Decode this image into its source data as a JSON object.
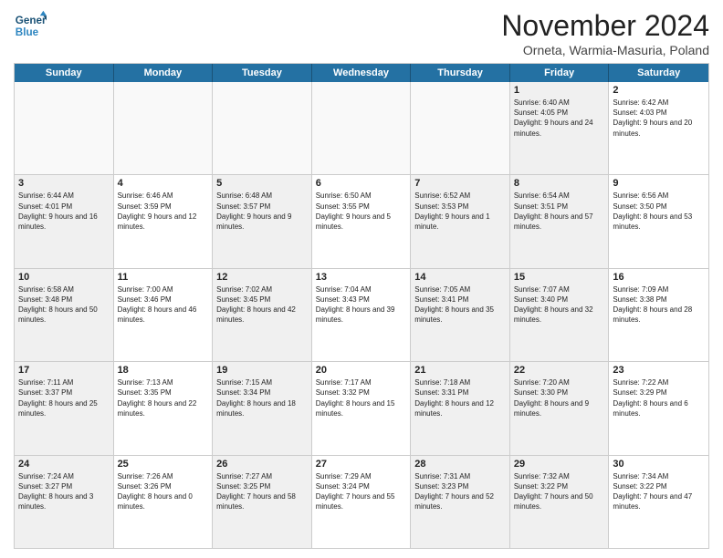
{
  "header": {
    "logo_line1": "General",
    "logo_line2": "Blue",
    "month_title": "November 2024",
    "subtitle": "Orneta, Warmia-Masuria, Poland"
  },
  "weekdays": [
    "Sunday",
    "Monday",
    "Tuesday",
    "Wednesday",
    "Thursday",
    "Friday",
    "Saturday"
  ],
  "rows": [
    [
      {
        "day": "",
        "info": "",
        "empty": true
      },
      {
        "day": "",
        "info": "",
        "empty": true
      },
      {
        "day": "",
        "info": "",
        "empty": true
      },
      {
        "day": "",
        "info": "",
        "empty": true
      },
      {
        "day": "",
        "info": "",
        "empty": true
      },
      {
        "day": "1",
        "info": "Sunrise: 6:40 AM\nSunset: 4:05 PM\nDaylight: 9 hours and 24 minutes.",
        "shaded": true
      },
      {
        "day": "2",
        "info": "Sunrise: 6:42 AM\nSunset: 4:03 PM\nDaylight: 9 hours and 20 minutes.",
        "shaded": false
      }
    ],
    [
      {
        "day": "3",
        "info": "Sunrise: 6:44 AM\nSunset: 4:01 PM\nDaylight: 9 hours and 16 minutes.",
        "shaded": true
      },
      {
        "day": "4",
        "info": "Sunrise: 6:46 AM\nSunset: 3:59 PM\nDaylight: 9 hours and 12 minutes.",
        "shaded": false
      },
      {
        "day": "5",
        "info": "Sunrise: 6:48 AM\nSunset: 3:57 PM\nDaylight: 9 hours and 9 minutes.",
        "shaded": true
      },
      {
        "day": "6",
        "info": "Sunrise: 6:50 AM\nSunset: 3:55 PM\nDaylight: 9 hours and 5 minutes.",
        "shaded": false
      },
      {
        "day": "7",
        "info": "Sunrise: 6:52 AM\nSunset: 3:53 PM\nDaylight: 9 hours and 1 minute.",
        "shaded": true
      },
      {
        "day": "8",
        "info": "Sunrise: 6:54 AM\nSunset: 3:51 PM\nDaylight: 8 hours and 57 minutes.",
        "shaded": true
      },
      {
        "day": "9",
        "info": "Sunrise: 6:56 AM\nSunset: 3:50 PM\nDaylight: 8 hours and 53 minutes.",
        "shaded": false
      }
    ],
    [
      {
        "day": "10",
        "info": "Sunrise: 6:58 AM\nSunset: 3:48 PM\nDaylight: 8 hours and 50 minutes.",
        "shaded": true
      },
      {
        "day": "11",
        "info": "Sunrise: 7:00 AM\nSunset: 3:46 PM\nDaylight: 8 hours and 46 minutes.",
        "shaded": false
      },
      {
        "day": "12",
        "info": "Sunrise: 7:02 AM\nSunset: 3:45 PM\nDaylight: 8 hours and 42 minutes.",
        "shaded": true
      },
      {
        "day": "13",
        "info": "Sunrise: 7:04 AM\nSunset: 3:43 PM\nDaylight: 8 hours and 39 minutes.",
        "shaded": false
      },
      {
        "day": "14",
        "info": "Sunrise: 7:05 AM\nSunset: 3:41 PM\nDaylight: 8 hours and 35 minutes.",
        "shaded": true
      },
      {
        "day": "15",
        "info": "Sunrise: 7:07 AM\nSunset: 3:40 PM\nDaylight: 8 hours and 32 minutes.",
        "shaded": true
      },
      {
        "day": "16",
        "info": "Sunrise: 7:09 AM\nSunset: 3:38 PM\nDaylight: 8 hours and 28 minutes.",
        "shaded": false
      }
    ],
    [
      {
        "day": "17",
        "info": "Sunrise: 7:11 AM\nSunset: 3:37 PM\nDaylight: 8 hours and 25 minutes.",
        "shaded": true
      },
      {
        "day": "18",
        "info": "Sunrise: 7:13 AM\nSunset: 3:35 PM\nDaylight: 8 hours and 22 minutes.",
        "shaded": false
      },
      {
        "day": "19",
        "info": "Sunrise: 7:15 AM\nSunset: 3:34 PM\nDaylight: 8 hours and 18 minutes.",
        "shaded": true
      },
      {
        "day": "20",
        "info": "Sunrise: 7:17 AM\nSunset: 3:32 PM\nDaylight: 8 hours and 15 minutes.",
        "shaded": false
      },
      {
        "day": "21",
        "info": "Sunrise: 7:18 AM\nSunset: 3:31 PM\nDaylight: 8 hours and 12 minutes.",
        "shaded": true
      },
      {
        "day": "22",
        "info": "Sunrise: 7:20 AM\nSunset: 3:30 PM\nDaylight: 8 hours and 9 minutes.",
        "shaded": true
      },
      {
        "day": "23",
        "info": "Sunrise: 7:22 AM\nSunset: 3:29 PM\nDaylight: 8 hours and 6 minutes.",
        "shaded": false
      }
    ],
    [
      {
        "day": "24",
        "info": "Sunrise: 7:24 AM\nSunset: 3:27 PM\nDaylight: 8 hours and 3 minutes.",
        "shaded": true
      },
      {
        "day": "25",
        "info": "Sunrise: 7:26 AM\nSunset: 3:26 PM\nDaylight: 8 hours and 0 minutes.",
        "shaded": false
      },
      {
        "day": "26",
        "info": "Sunrise: 7:27 AM\nSunset: 3:25 PM\nDaylight: 7 hours and 58 minutes.",
        "shaded": true
      },
      {
        "day": "27",
        "info": "Sunrise: 7:29 AM\nSunset: 3:24 PM\nDaylight: 7 hours and 55 minutes.",
        "shaded": false
      },
      {
        "day": "28",
        "info": "Sunrise: 7:31 AM\nSunset: 3:23 PM\nDaylight: 7 hours and 52 minutes.",
        "shaded": true
      },
      {
        "day": "29",
        "info": "Sunrise: 7:32 AM\nSunset: 3:22 PM\nDaylight: 7 hours and 50 minutes.",
        "shaded": true
      },
      {
        "day": "30",
        "info": "Sunrise: 7:34 AM\nSunset: 3:22 PM\nDaylight: 7 hours and 47 minutes.",
        "shaded": false
      }
    ]
  ]
}
